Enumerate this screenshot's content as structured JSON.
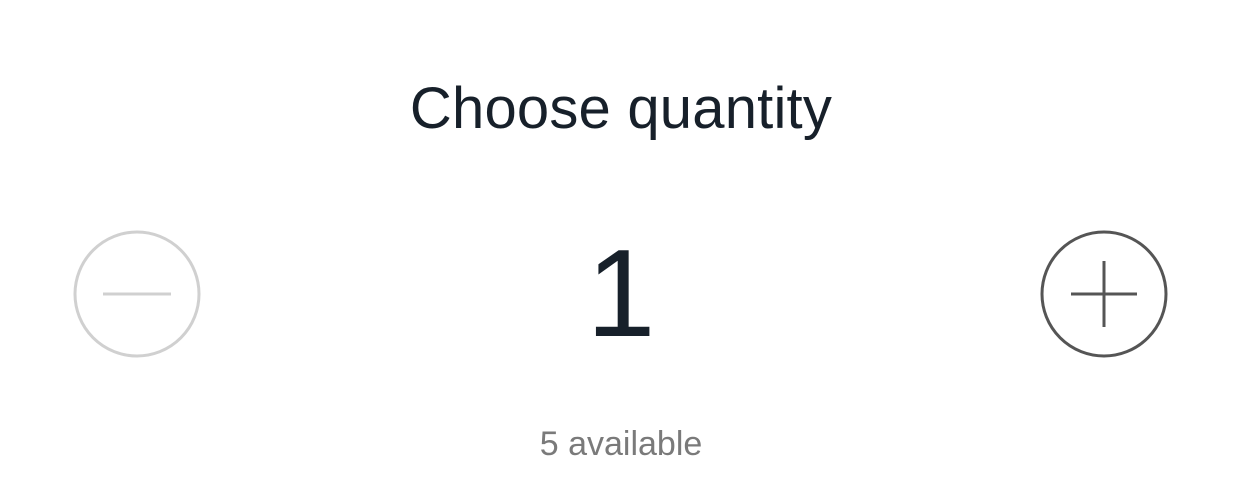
{
  "quantity_picker": {
    "title": "Choose quantity",
    "quantity_value": "1",
    "availability_text": "5 available",
    "decrement": {
      "icon": "minus-icon",
      "enabled": false,
      "color": "#d0d0d0"
    },
    "increment": {
      "icon": "plus-icon",
      "enabled": true,
      "color": "#555555"
    }
  }
}
